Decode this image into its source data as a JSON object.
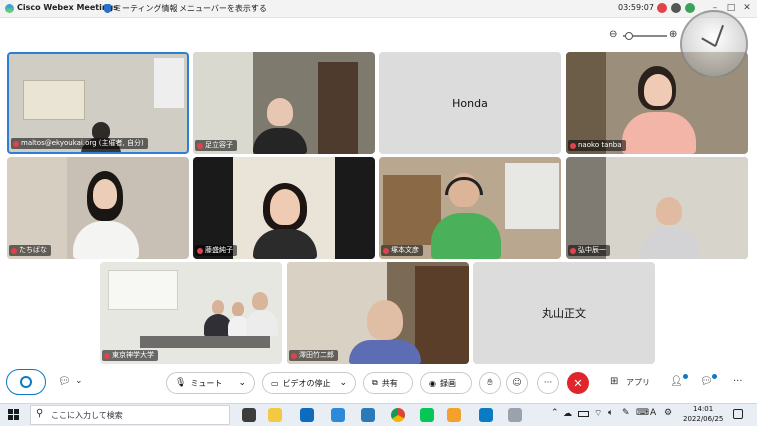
{
  "titlebar": {
    "app_name": "Cisco Webex Meetings",
    "meeting_info": "ミーティング情報",
    "menu_toggle": "メニューバーを表示する",
    "timer": "03:59:07"
  },
  "participants": [
    {
      "id": "p1",
      "name": "maltos@ekyoukai.org (主催者, 自分)"
    },
    {
      "id": "p2",
      "name": "足立容子"
    },
    {
      "id": "p3",
      "name": "Honda"
    },
    {
      "id": "p4",
      "name": "naoko tanba"
    },
    {
      "id": "p5",
      "name": "たちばな"
    },
    {
      "id": "p6",
      "name": "藤盛純子"
    },
    {
      "id": "p7",
      "name": "塚本文彦"
    },
    {
      "id": "p8",
      "name": "弘中辰一"
    },
    {
      "id": "p9",
      "name": "東京神学大学"
    },
    {
      "id": "p10",
      "name": "澤田竹二郎"
    },
    {
      "id": "p11",
      "name": "丸山正文"
    }
  ],
  "toolbar": {
    "mute": "ミュート",
    "stop_video": "ビデオの停止",
    "share": "共有",
    "record": "録画",
    "apps": "アプリ"
  },
  "taskbar": {
    "search_placeholder": "ここに入力して検索",
    "time": "14:01",
    "date": "2022/06/25"
  },
  "colors": {
    "end_button": "#e0262d",
    "active_border": "#2d7fd3",
    "tile_gray": "#dcdcdc",
    "accent": "#0a7bc4"
  }
}
